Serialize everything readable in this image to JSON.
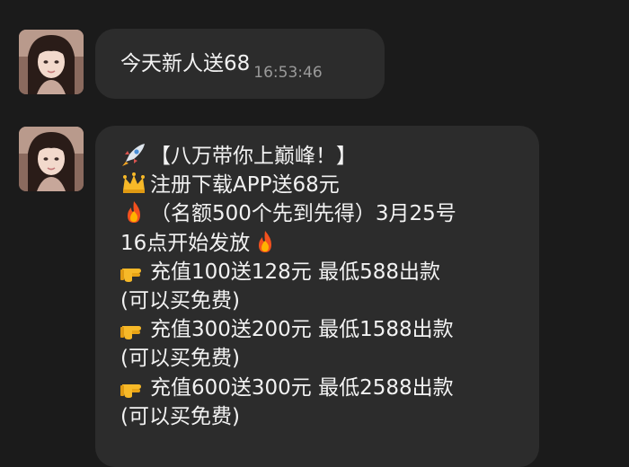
{
  "messages": [
    {
      "text": "今天新人送68",
      "time": "16:53:46"
    },
    {
      "lines": [
        {
          "icon": "rocket-emoji",
          "text": "【八万带你上巅峰！】"
        },
        {
          "icon": "crown-emoji",
          "text": "注册下载APP送68元"
        },
        {
          "icon": "fire-emoji",
          "text": "（名额500个先到先得）3月25号"
        },
        {
          "icon": "",
          "text": "16点开始发放",
          "trail_icon": "fire-emoji"
        },
        {
          "icon": "pointing-hand-emoji",
          "text": "充值100送128元 最低588出款"
        },
        {
          "icon": "",
          "text": "(可以买免费)"
        },
        {
          "icon": "pointing-hand-emoji",
          "text": "充值300送200元 最低1588出款"
        },
        {
          "icon": "",
          "text": "(可以买免费)"
        },
        {
          "icon": "pointing-hand-emoji",
          "text": "充值600送300元 最低2588出款"
        },
        {
          "icon": "",
          "text": "(可以买免费)"
        }
      ]
    }
  ],
  "colors": {
    "background": "#1b1b1b",
    "bubble": "#2c2c2c",
    "text": "#f2f2f2",
    "timestamp": "#9a9a9a"
  }
}
